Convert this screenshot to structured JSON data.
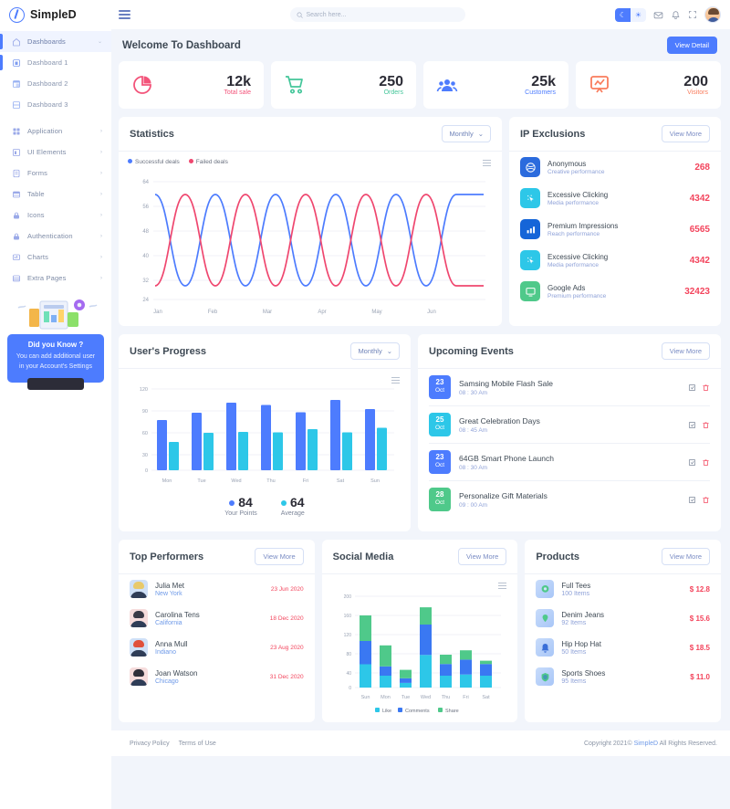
{
  "header": {
    "brand": "SimpleD",
    "menu_icon": "hamburger-icon",
    "search_placeholder": "Search here...",
    "search_value": "",
    "dark_icon": "moon-icon",
    "light_icon": "sun-icon",
    "mail_icon": "mail-icon",
    "bell_icon": "bell-icon",
    "fullscreen_icon": "fullscreen-icon",
    "avatar": "user-avatar"
  },
  "sidebar": {
    "items": [
      {
        "label": "Dashboards",
        "icon": "home-icon",
        "active": true,
        "chevron": "chevron-down"
      },
      {
        "label": "Dashboard 1",
        "icon": "dashboard-icon",
        "sub": true
      },
      {
        "label": "Dashboard 2",
        "icon": "grid-icon",
        "sub": true
      },
      {
        "label": "Dashboard 3",
        "icon": "layout-icon",
        "sub": true
      },
      {
        "label": "Application",
        "icon": "apps-icon",
        "chevron": "chevron-right"
      },
      {
        "label": "UI Elements",
        "icon": "ui-icon",
        "chevron": "chevron-right"
      },
      {
        "label": "Forms",
        "icon": "form-icon",
        "chevron": "chevron-right"
      },
      {
        "label": "Table",
        "icon": "table-icon",
        "chevron": "chevron-right"
      },
      {
        "label": "Icons",
        "icon": "lock-icon",
        "chevron": "chevron-right"
      },
      {
        "label": "Authentication",
        "icon": "auth-icon",
        "chevron": "chevron-right"
      },
      {
        "label": "Charts",
        "icon": "chart-icon",
        "chevron": "chevron-right"
      },
      {
        "label": "Extra Pages",
        "icon": "pages-icon",
        "chevron": "chevron-right"
      }
    ],
    "promo": {
      "title": "Did you Know ?",
      "text": "You can add additional user in your Account's Settings"
    }
  },
  "welcome": {
    "title": "Welcome To Dashboard",
    "view_detail": "View Detail"
  },
  "stats": [
    {
      "value": "12k",
      "label": "Total sale",
      "color": "#f3547a",
      "icon": "pie-chart-icon"
    },
    {
      "value": "250",
      "label": "Orders",
      "color": "#44c69a",
      "icon": "cart-icon"
    },
    {
      "value": "25k",
      "label": "Customers",
      "color": "#4d7cfe",
      "icon": "users-icon"
    },
    {
      "value": "200",
      "label": "Visitors",
      "color": "#f97c5c",
      "icon": "presentation-chart-icon"
    }
  ],
  "statistics": {
    "title": "Statistics",
    "period": "Monthly",
    "menu_icon": "chart-menu-icon"
  },
  "ip_exclusions": {
    "title": "IP Exclusions",
    "view_more": "View More",
    "rows": [
      {
        "name": "Anonymous",
        "sub": "Creative performance",
        "value": "268",
        "color": "#2b6bdd",
        "icon": "globe-icon"
      },
      {
        "name": "Excessive Clicking",
        "sub": "Media performance",
        "value": "4342",
        "color": "#2dc7e8",
        "icon": "click-icon"
      },
      {
        "name": "Premium Impressions",
        "sub": "Reach performance",
        "value": "6565",
        "color": "#1565d8",
        "icon": "bar-chart-icon"
      },
      {
        "name": "Excessive Clicking",
        "sub": "Media performance",
        "value": "4342",
        "color": "#2dc7e8",
        "icon": "click-icon"
      },
      {
        "name": "Google Ads",
        "sub": "Premium performance",
        "value": "32423",
        "color": "#4fc98a",
        "icon": "monitor-icon"
      }
    ]
  },
  "users_progress": {
    "title": "User's Progress",
    "period": "Monthly",
    "menu_icon": "chart-menu-icon",
    "summary": [
      {
        "value": "84",
        "label": "Your Points",
        "color": "#4d7cfe"
      },
      {
        "value": "64",
        "label": "Average",
        "color": "#2dc7e8"
      }
    ]
  },
  "upcoming_events": {
    "title": "Upcoming Events",
    "view_more": "View More",
    "rows": [
      {
        "day": "23",
        "month": "Oct",
        "title": "Samsing Mobile Flash Sale",
        "time": "08 : 30 Am",
        "color": "#4d7cfe"
      },
      {
        "day": "25",
        "month": "Oct",
        "title": "Great Celebration Days",
        "time": "08 : 45 Am",
        "color": "#2dc7e8"
      },
      {
        "day": "23",
        "month": "Oct",
        "title": "64GB Smart Phone Launch",
        "time": "08 : 30 Am",
        "color": "#4d7cfe"
      },
      {
        "day": "28",
        "month": "Oct",
        "title": "Personalize Gift Materials",
        "time": "09 : 00 Am",
        "color": "#4fc98a"
      }
    ],
    "edit_icon": "edit-icon",
    "delete_icon": "trash-icon"
  },
  "top_performers": {
    "title": "Top Performers",
    "view_more": "View More",
    "rows": [
      {
        "name": "Julia Met",
        "city": "New York",
        "date": "23 Jun 2020",
        "hair": "#e8c96a",
        "bg": "#cfe0f7"
      },
      {
        "name": "Carolina Tens",
        "city": "California",
        "date": "18 Dec 2020",
        "hair": "#3a3a46",
        "bg": "#f6dcdc"
      },
      {
        "name": "Anna Mull",
        "city": "Indiano",
        "date": "23 Aug 2020",
        "hair": "#e0503c",
        "bg": "#cfe0f7"
      },
      {
        "name": "Joan Watson",
        "city": "Chicago",
        "date": "31 Dec 2020",
        "hair": "#2f2f3a",
        "bg": "#f6dcdc"
      }
    ]
  },
  "social_media": {
    "title": "Social Media",
    "view_more": "View More",
    "menu_icon": "chart-menu-icon"
  },
  "products": {
    "title": "Products",
    "view_more": "View More",
    "rows": [
      {
        "name": "Full Tees",
        "items": "100 Items",
        "price": "$ 12.8",
        "icon": "shirt-icon",
        "color": "#4fc98a"
      },
      {
        "name": "Denim Jeans",
        "items": "92 Items",
        "price": "$ 15.6",
        "icon": "pin-icon",
        "color": "#4fc98a"
      },
      {
        "name": "Hip Hop Hat",
        "items": "50 Items",
        "price": "$ 18.5",
        "icon": "bell-icon",
        "color": "#3a6fd8"
      },
      {
        "name": "Sports Shoes",
        "items": "95 Items",
        "price": "$ 11.0",
        "icon": "shield-icon",
        "color": "#4fc98a"
      }
    ]
  },
  "footer": {
    "privacy": "Privacy Policy",
    "terms": "Terms of Use",
    "copyright_pre": "Copyright 2021© ",
    "brand": "SimpleD",
    "copyright_post": " All Rights Reserved."
  },
  "chart_data": [
    {
      "id": "statistics",
      "type": "line",
      "title": "Statistics",
      "xlabel": "",
      "ylabel": "",
      "categories": [
        "Jan",
        "Feb",
        "Mar",
        "Apr",
        "May",
        "Jun"
      ],
      "yticks": [
        24,
        32,
        40,
        48,
        56,
        64
      ],
      "ylim": [
        24,
        64
      ],
      "grid": true,
      "legend_position": "top-left",
      "series": [
        {
          "name": "Successful deals",
          "color": "#4d7cfe",
          "values": [
            60,
            48,
            30,
            48,
            60,
            48,
            30,
            48,
            60,
            48,
            30,
            48,
            60
          ]
        },
        {
          "name": "Failed deals",
          "color": "#ef476f",
          "values": [
            30,
            44,
            60,
            44,
            30,
            44,
            60,
            44,
            30,
            44,
            60,
            44,
            30
          ]
        }
      ]
    },
    {
      "id": "users-progress",
      "type": "bar",
      "title": "User's Progress",
      "categories": [
        "Mon",
        "Tue",
        "Wed",
        "Thu",
        "Fri",
        "Sat",
        "Sun"
      ],
      "yticks": [
        0,
        30,
        60,
        90,
        120
      ],
      "ylim": [
        0,
        120
      ],
      "grid": true,
      "series": [
        {
          "name": "Your Points",
          "color": "#4d7cfe",
          "values": [
            74,
            85,
            100,
            97,
            86,
            104,
            90
          ]
        },
        {
          "name": "Average",
          "color": "#2dc7e8",
          "values": [
            42,
            55,
            57,
            56,
            60,
            57,
            62
          ]
        }
      ]
    },
    {
      "id": "social-media",
      "type": "bar",
      "stacked": true,
      "title": "Social Media",
      "categories": [
        "Sun",
        "Mon",
        "Tue",
        "Wed",
        "Thu",
        "Fri",
        "Sat"
      ],
      "yticks": [
        0,
        40,
        80,
        120,
        160,
        200
      ],
      "ylim": [
        0,
        200
      ],
      "grid": true,
      "legend_position": "bottom",
      "series": [
        {
          "name": "Like",
          "color": "#2dc7e8",
          "values": [
            50,
            25,
            10,
            70,
            25,
            28,
            25
          ]
        },
        {
          "name": "Comments",
          "color": "#3a78f2",
          "values": [
            50,
            20,
            10,
            65,
            25,
            32,
            25
          ]
        },
        {
          "name": "Share",
          "color": "#4fc98a",
          "values": [
            55,
            45,
            18,
            37,
            20,
            20,
            7
          ]
        }
      ]
    }
  ]
}
